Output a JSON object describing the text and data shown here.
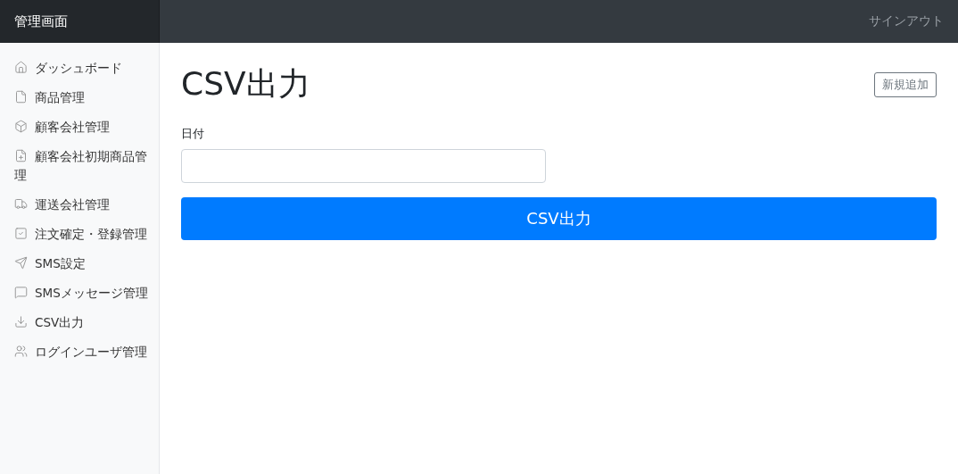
{
  "navbar": {
    "brand": "管理画面",
    "signout": "サインアウト"
  },
  "sidebar": {
    "items": [
      {
        "label": "ダッシュボード"
      },
      {
        "label": "商品管理"
      },
      {
        "label": "顧客会社管理"
      },
      {
        "label": "顧客会社初期商品管理"
      },
      {
        "label": "運送会社管理"
      },
      {
        "label": "注文確定・登録管理"
      },
      {
        "label": "SMS設定"
      },
      {
        "label": "SMSメッセージ管理"
      },
      {
        "label": "CSV出力"
      },
      {
        "label": "ログインユーザ管理"
      }
    ]
  },
  "main": {
    "title": "CSV出力",
    "add_button": "新規追加",
    "field_label": "日付",
    "submit": "CSV出力"
  }
}
